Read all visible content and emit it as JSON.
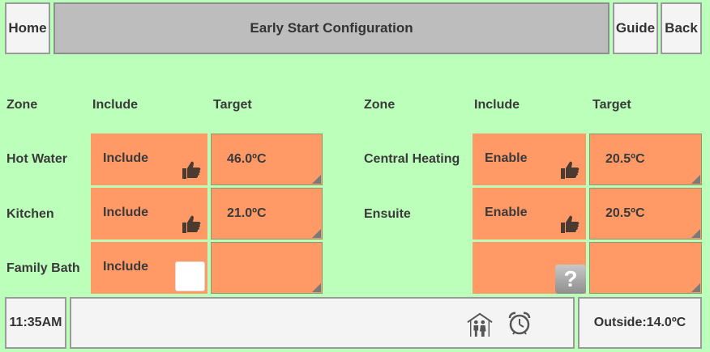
{
  "header": {
    "home_label": "Home",
    "title": "Early Start Configuration",
    "guide_label": "Guide",
    "back_label": "Back"
  },
  "columns": {
    "left": {
      "zone": "Zone",
      "include": "Include",
      "target": "Target"
    },
    "right": {
      "zone": "Zone",
      "include": "Include",
      "target": "Target"
    }
  },
  "left_rows": [
    {
      "zone": "Hot Water",
      "include": "Include",
      "include_icon": "thumbs-up-icon",
      "target": "46.0ºC"
    },
    {
      "zone": "Kitchen",
      "include": "Include",
      "include_icon": "thumbs-up-icon",
      "target": "21.0ºC"
    },
    {
      "zone": "Family Bath",
      "include": "Include",
      "include_icon": "empty-checkbox-icon",
      "target": ""
    }
  ],
  "right_rows": [
    {
      "zone": "Central Heating",
      "include": "Enable",
      "include_icon": "thumbs-up-icon",
      "target": "20.5ºC"
    },
    {
      "zone": "Ensuite",
      "include": "Enable",
      "include_icon": "thumbs-up-icon",
      "target": "20.5ºC"
    },
    {
      "zone": "",
      "include": "",
      "include_icon": "question-mark-icon",
      "target": ""
    }
  ],
  "footer": {
    "time": "11:35AM",
    "status_icons": [
      "home-occupied-icon",
      "alarm-clock-icon"
    ],
    "outside": "Outside:14.0ºC"
  },
  "colors": {
    "background": "#bbffbb",
    "cell": "#ff9966",
    "title_bar": "#bdbdbd",
    "button": "#f4f4f4"
  }
}
